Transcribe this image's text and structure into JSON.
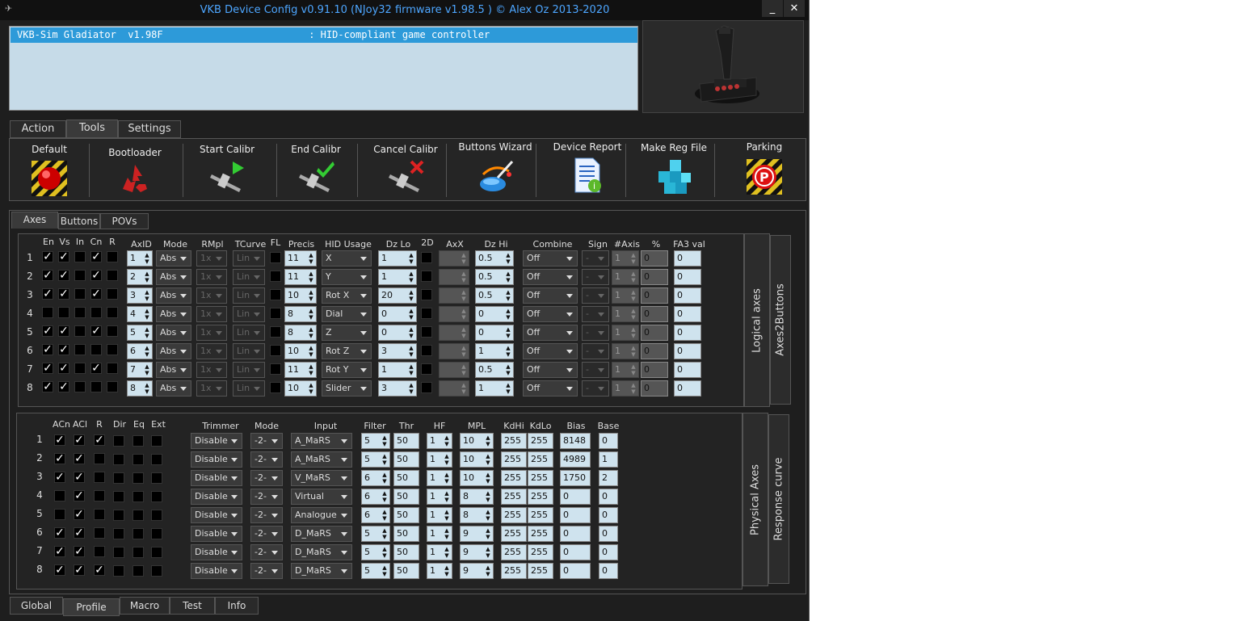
{
  "window": {
    "title": "VKB Device Config v0.91.10 (NJoy32 firmware v1.98.5  ) © Alex Oz 2013-2020",
    "minimize": "_",
    "close": "✕"
  },
  "device_list": {
    "row": "VKB-Sim Gladiator  v1.98F                         : HID-compliant game controller"
  },
  "top_tabs": [
    "Action",
    "Tools",
    "Settings"
  ],
  "top_tab_selected": "Tools",
  "tools": [
    {
      "label": "Default",
      "icon": "red-button-icon"
    },
    {
      "label": "Bootloader",
      "icon": "recycle-icon"
    },
    {
      "label": "Start Calibr",
      "icon": "caliper-play-icon"
    },
    {
      "label": "End Calibr",
      "icon": "caliper-check-icon"
    },
    {
      "label": "Cancel Calibr",
      "icon": "caliper-cross-icon"
    },
    {
      "label": "Buttons Wizard",
      "icon": "wizard-icon"
    },
    {
      "label": "Device Report",
      "icon": "report-icon"
    },
    {
      "label": "Make Reg File",
      "icon": "cubes-icon"
    },
    {
      "label": "Parking",
      "icon": "parking-icon"
    }
  ],
  "sub_tabs": [
    "Axes",
    "Buttons",
    "POVs"
  ],
  "logical": {
    "side_tabs": [
      "Logical axes",
      "Axes2Buttons"
    ],
    "headers": {
      "en": "En",
      "vs": "Vs",
      "in": "In",
      "cn": "Cn",
      "r": "R",
      "axid": "AxID",
      "mode": "Mode",
      "rmpl": "RMpl",
      "tcurve": "TCurve",
      "fl": "FL",
      "precis": "Precis",
      "hid": "HID Usage",
      "dzlo": "Dz Lo",
      "d2": "2D",
      "axx": "AxX",
      "dzhi": "Dz Hi",
      "combine": "Combine",
      "sign": "Sign",
      "naxis": "#Axis",
      "pct": "%",
      "fa3": "FA3 val"
    },
    "rows": [
      {
        "n": "1",
        "en": true,
        "vs": true,
        "in": false,
        "cn": true,
        "r": false,
        "axid": "1",
        "mode": "Abs",
        "rmpl": "1x",
        "tcurve": "Lin",
        "precis": "11",
        "hid": "X",
        "dzlo": "1",
        "dzhi": "0.5",
        "combine": "Off",
        "sign": "-",
        "naxis": "1",
        "pct": "0",
        "fa3": "0"
      },
      {
        "n": "2",
        "en": true,
        "vs": true,
        "in": false,
        "cn": true,
        "r": false,
        "axid": "2",
        "mode": "Abs",
        "rmpl": "1x",
        "tcurve": "Lin",
        "precis": "11",
        "hid": "Y",
        "dzlo": "1",
        "dzhi": "0.5",
        "combine": "Off",
        "sign": "-",
        "naxis": "1",
        "pct": "0",
        "fa3": "0"
      },
      {
        "n": "3",
        "en": true,
        "vs": true,
        "in": false,
        "cn": true,
        "r": false,
        "axid": "3",
        "mode": "Abs",
        "rmpl": "1x",
        "tcurve": "Lin",
        "precis": "10",
        "hid": "Rot X",
        "dzlo": "20",
        "dzhi": "0.5",
        "combine": "Off",
        "sign": "-",
        "naxis": "1",
        "pct": "0",
        "fa3": "0"
      },
      {
        "n": "4",
        "en": false,
        "vs": false,
        "in": false,
        "cn": false,
        "r": false,
        "axid": "4",
        "mode": "Abs",
        "rmpl": "1x",
        "tcurve": "Lin",
        "precis": "8",
        "hid": "Dial",
        "dzlo": "0",
        "dzhi": "0",
        "combine": "Off",
        "sign": "-",
        "naxis": "1",
        "pct": "0",
        "fa3": "0"
      },
      {
        "n": "5",
        "en": true,
        "vs": true,
        "in": false,
        "cn": true,
        "r": false,
        "axid": "5",
        "mode": "Abs",
        "rmpl": "1x",
        "tcurve": "Lin",
        "precis": "8",
        "hid": "Z",
        "dzlo": "0",
        "dzhi": "0",
        "combine": "Off",
        "sign": "-",
        "naxis": "1",
        "pct": "0",
        "fa3": "0"
      },
      {
        "n": "6",
        "en": true,
        "vs": true,
        "in": false,
        "cn": false,
        "r": false,
        "axid": "6",
        "mode": "Abs",
        "rmpl": "1x",
        "tcurve": "Lin",
        "precis": "10",
        "hid": "Rot Z",
        "dzlo": "3",
        "dzhi": "1",
        "combine": "Off",
        "sign": "-",
        "naxis": "1",
        "pct": "0",
        "fa3": "0"
      },
      {
        "n": "7",
        "en": true,
        "vs": true,
        "in": false,
        "cn": true,
        "r": false,
        "axid": "7",
        "mode": "Abs",
        "rmpl": "1x",
        "tcurve": "Lin",
        "precis": "11",
        "hid": "Rot Y",
        "dzlo": "1",
        "dzhi": "0.5",
        "combine": "Off",
        "sign": "-",
        "naxis": "1",
        "pct": "0",
        "fa3": "0"
      },
      {
        "n": "8",
        "en": true,
        "vs": true,
        "in": false,
        "cn": false,
        "r": false,
        "axid": "8",
        "mode": "Abs",
        "rmpl": "1x",
        "tcurve": "Lin",
        "precis": "10",
        "hid": "Slider",
        "dzlo": "3",
        "dzhi": "1",
        "combine": "Off",
        "sign": "-",
        "naxis": "1",
        "pct": "0",
        "fa3": "0"
      }
    ]
  },
  "physical": {
    "side_tabs": [
      "Physical Axes",
      "Response curve"
    ],
    "headers": {
      "acn": "ACn",
      "acl": "ACl",
      "r": "R",
      "dir": "Dir",
      "eq": "Eq",
      "ext": "Ext",
      "trimmer": "Trimmer",
      "mode": "Mode",
      "input": "Input",
      "filter": "Filter",
      "thr": "Thr",
      "hf": "HF",
      "mpl": "MPL",
      "kdhi": "KdHi",
      "kdlo": "KdLo",
      "bias": "Bias",
      "base": "Base"
    },
    "rows": [
      {
        "n": "1",
        "acn": true,
        "acl": true,
        "r": true,
        "trimmer": "Disable",
        "mode": "-2-",
        "input": "A_MaRS",
        "filter": "5",
        "thr": "50",
        "hf": "1",
        "mpl": "10",
        "kdhi": "255",
        "kdlo": "255",
        "bias": "8148",
        "base": "0"
      },
      {
        "n": "2",
        "acn": true,
        "acl": true,
        "r": false,
        "trimmer": "Disable",
        "mode": "-2-",
        "input": "A_MaRS",
        "filter": "5",
        "thr": "50",
        "hf": "1",
        "mpl": "10",
        "kdhi": "255",
        "kdlo": "255",
        "bias": "4989",
        "base": "1"
      },
      {
        "n": "3",
        "acn": true,
        "acl": true,
        "r": false,
        "trimmer": "Disable",
        "mode": "-2-",
        "input": "V_MaRS",
        "filter": "6",
        "thr": "50",
        "hf": "1",
        "mpl": "10",
        "kdhi": "255",
        "kdlo": "255",
        "bias": "1750",
        "base": "2"
      },
      {
        "n": "4",
        "acn": false,
        "acl": true,
        "r": false,
        "trimmer": "Disable",
        "mode": "-2-",
        "input": "Virtual",
        "filter": "6",
        "thr": "50",
        "hf": "1",
        "mpl": "8",
        "kdhi": "255",
        "kdlo": "255",
        "bias": "0",
        "base": "0"
      },
      {
        "n": "5",
        "acn": false,
        "acl": true,
        "r": false,
        "trimmer": "Disable",
        "mode": "-2-",
        "input": "Analogue",
        "filter": "6",
        "thr": "50",
        "hf": "1",
        "mpl": "8",
        "kdhi": "255",
        "kdlo": "255",
        "bias": "0",
        "base": "0"
      },
      {
        "n": "6",
        "acn": true,
        "acl": true,
        "r": false,
        "trimmer": "Disable",
        "mode": "-2-",
        "input": "D_MaRS",
        "filter": "5",
        "thr": "50",
        "hf": "1",
        "mpl": "9",
        "kdhi": "255",
        "kdlo": "255",
        "bias": "0",
        "base": "0"
      },
      {
        "n": "7",
        "acn": true,
        "acl": true,
        "r": false,
        "trimmer": "Disable",
        "mode": "-2-",
        "input": "D_MaRS",
        "filter": "5",
        "thr": "50",
        "hf": "1",
        "mpl": "9",
        "kdhi": "255",
        "kdlo": "255",
        "bias": "0",
        "base": "0"
      },
      {
        "n": "8",
        "acn": true,
        "acl": true,
        "r": true,
        "trimmer": "Disable",
        "mode": "-2-",
        "input": "D_MaRS",
        "filter": "5",
        "thr": "50",
        "hf": "1",
        "mpl": "9",
        "kdhi": "255",
        "kdlo": "255",
        "bias": "0",
        "base": "0"
      }
    ]
  },
  "bottom_tabs": [
    "Global",
    "Profile",
    "Macro",
    "Test",
    "Info"
  ],
  "bottom_tab_selected": "Profile"
}
